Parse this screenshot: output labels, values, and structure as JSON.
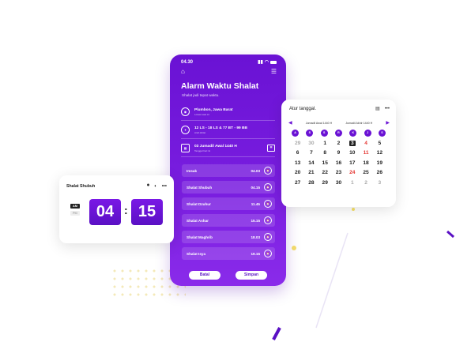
{
  "phone": {
    "status_time": "04.30",
    "title": "Alarm Waktu Shalat",
    "subtitle": "Shalat jadi tepat waktu.",
    "info": [
      {
        "main": "Plumbon, Jawa Barat",
        "tag": "Lokasi saat ini"
      },
      {
        "main": "12 LS - 18 LS & 77 BT - 99 BB",
        "tag": "Arah kiblat"
      },
      {
        "main": "03 Jumadil Awal 1440 H",
        "tag": "Tanggal hari ini"
      }
    ],
    "alarms": [
      {
        "name": "Imsak",
        "time": "04.03"
      },
      {
        "name": "Shalat Shubuh",
        "time": "04.15"
      },
      {
        "name": "Shalat Dzuhur",
        "time": "11.45"
      },
      {
        "name": "Shalat Ashar",
        "time": "15.15"
      },
      {
        "name": "Shalat Maghrib",
        "time": "18.03"
      },
      {
        "name": "Shalat Isya",
        "time": "19.15"
      }
    ],
    "cancel_label": "Batal",
    "save_label": "Simpan"
  },
  "calendar": {
    "title": "Atur tanggal.",
    "prev_month": "Jumadil Awal 1440 H",
    "next_month": "Jumadil Akhir 1440 H",
    "dows": [
      "A",
      "S",
      "S",
      "R",
      "K",
      "J",
      "S"
    ],
    "rows": [
      [
        {
          "d": "29",
          "s": "muted"
        },
        {
          "d": "30",
          "s": "muted"
        },
        {
          "d": "1",
          "s": ""
        },
        {
          "d": "2",
          "s": ""
        },
        {
          "d": "3",
          "s": "sel"
        },
        {
          "d": "4",
          "s": "red"
        },
        {
          "d": "5",
          "s": ""
        }
      ],
      [
        {
          "d": "6",
          "s": ""
        },
        {
          "d": "7",
          "s": ""
        },
        {
          "d": "8",
          "s": ""
        },
        {
          "d": "9",
          "s": ""
        },
        {
          "d": "10",
          "s": ""
        },
        {
          "d": "11",
          "s": "red"
        },
        {
          "d": "12",
          "s": ""
        }
      ],
      [
        {
          "d": "13",
          "s": ""
        },
        {
          "d": "14",
          "s": ""
        },
        {
          "d": "15",
          "s": ""
        },
        {
          "d": "16",
          "s": ""
        },
        {
          "d": "17",
          "s": ""
        },
        {
          "d": "18",
          "s": ""
        },
        {
          "d": "19",
          "s": ""
        }
      ],
      [
        {
          "d": "20",
          "s": ""
        },
        {
          "d": "21",
          "s": ""
        },
        {
          "d": "22",
          "s": ""
        },
        {
          "d": "23",
          "s": ""
        },
        {
          "d": "24",
          "s": "red"
        },
        {
          "d": "25",
          "s": ""
        },
        {
          "d": "26",
          "s": ""
        }
      ],
      [
        {
          "d": "27",
          "s": ""
        },
        {
          "d": "28",
          "s": ""
        },
        {
          "d": "29",
          "s": ""
        },
        {
          "d": "30",
          "s": ""
        },
        {
          "d": "1",
          "s": "muted"
        },
        {
          "d": "2",
          "s": "muted"
        },
        {
          "d": "3",
          "s": "muted"
        }
      ]
    ]
  },
  "alarm_card": {
    "title": "Shalat Shubuh",
    "am": "AM",
    "pm": "PM",
    "hour": "04",
    "minute": "15",
    "separator": ":"
  },
  "colors": {
    "accent": "#6a12d4",
    "red": "#e53935"
  }
}
